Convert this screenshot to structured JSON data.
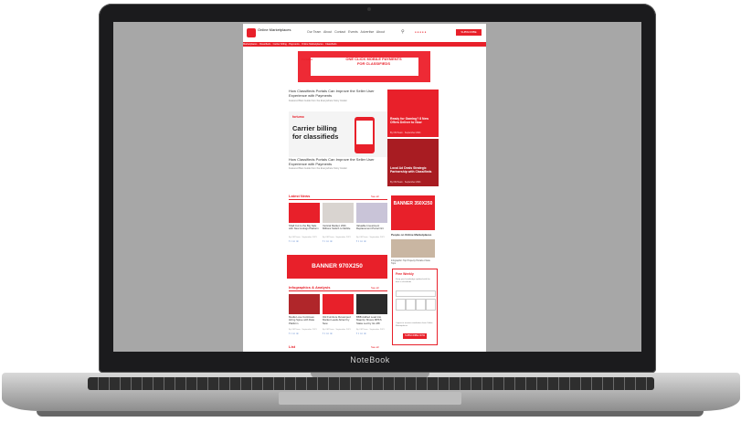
{
  "device": {
    "brand_label": "NoteBook"
  },
  "site": {
    "logo_text": "Online Marketplaces",
    "nav_items": [
      "Our Team",
      "About",
      "Contact",
      "Events",
      "Advertise",
      "About"
    ],
    "search_icon": "search-icon",
    "subscribe_label": "SUBSCRIBE",
    "ticker_text": "Marketplaces · Classifieds · Carrier billing · Payments · Online Marketplaces · Classifieds",
    "top_ad": {
      "brand": "Fortumo",
      "text": "ONE CLICK MOBILE PAYMENTS FOR CLASSIFIEDS"
    },
    "featured_top": {
      "title": "How Classifieds Portals Can Improve the Seller User Experience with Payments",
      "meta": "Featured Best Guide from the Everywhere Story Insider"
    },
    "hero": {
      "brand": "fortumo",
      "headline": "Carrier billing for classifieds"
    },
    "featured_bottom": {
      "title": "How Classifieds Portals Can Improve the Seller User Experience with Payments",
      "meta": "Featured Best Guide from the Everywhere Story Insider"
    },
    "side_cards": [
      {
        "title": "Ready for Gaming? 8 New Offers Deliver to Now",
        "meta": "By OM Team · September 2021"
      },
      {
        "title": "Local Ad Deals Strategic Partnership with Classifieds",
        "meta": "By OM Team · September 2021"
      }
    ],
    "latest_news": {
      "title": "Latest News",
      "see_all": "See all",
      "items": [
        {
          "title": "Shall Cut to the Big Sale with New Listings Platform",
          "meta": "By OM Team · September 2021",
          "share": "f t in ✉"
        },
        {
          "title": "Vertical Market: With Millions Switch to Mobile",
          "meta": "By OM Team · September 2021",
          "share": "f t in ✉"
        },
        {
          "title": "Valuable Investment Replacement Portal Oct",
          "meta": "By OM Team · September 2021",
          "share": "f t in ✉"
        }
      ]
    },
    "banner_350": "BANNER 350X250",
    "side_panel_title": "People on Online Marketplaces",
    "side_image_caption": "Infographic: Top Property Portals of Asia Tops",
    "banner_970": "BANNER 970X250",
    "infographics": {
      "title": "Infographics & Analysis",
      "see_all": "See all",
      "items": [
        {
          "title": "Media Love Continues Hiring Spree with Data Platform",
          "meta": "By OM Team · September 2021",
          "share": "f t in ✉"
        },
        {
          "title": "Old Furniture Revamped Market Leads Attract by New",
          "meta": "By OM Team · September 2021",
          "share": "f t in ✉"
        },
        {
          "title": "BBB Addled Lead into Majority Shows MPKS Stake Led by GL.M8",
          "meta": "By OM Team · September 2021",
          "share": "f t in ✉"
        }
      ]
    },
    "newsletter": {
      "title": "Free Weekly",
      "description": "Keep your knowledge updated with the best in classifieds",
      "button": "SUBSCRIBE NOW",
      "consent": "I agree to receive newsletters from Online Marketplaces"
    },
    "bottom_section": {
      "title": "List",
      "see_all": "See all"
    }
  }
}
